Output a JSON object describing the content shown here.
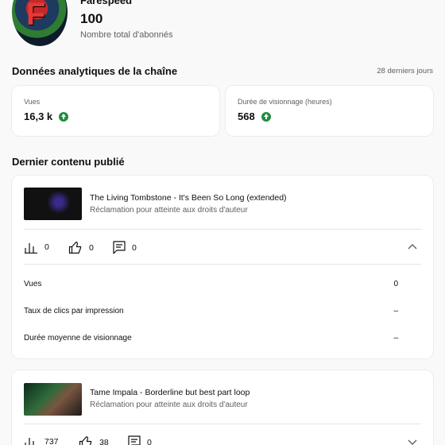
{
  "channel": {
    "name": "Farespeed",
    "avatar_letter": "F",
    "subscriber_count": "100",
    "subscriber_label": "Nombre total d'abonnés"
  },
  "analytics": {
    "title": "Données analytiques de la chaîne",
    "period": "28 derniers jours",
    "stats": [
      {
        "label": "Vues",
        "value": "16,3 k",
        "trend": "up"
      },
      {
        "label": "Durée de visionnage (heures)",
        "value": "568",
        "trend": "up"
      }
    ]
  },
  "latest": {
    "title": "Dernier contenu publié",
    "videos": [
      {
        "title": "The Living Tombstone - It's Been So Long (extended)",
        "claim": "Réclamation pour atteinte aux droits d'auteur",
        "views": "0",
        "likes": "0",
        "comments": "0",
        "expanded": true,
        "details": [
          {
            "label": "Vues",
            "value": "0"
          },
          {
            "label": "Taux de clics par impression",
            "value": "–"
          },
          {
            "label": "Durée moyenne de visionnage",
            "value": "–"
          }
        ]
      },
      {
        "title": "Tame Impala - Borderline but best part loop",
        "claim": "Réclamation pour atteinte aux droits d'auteur",
        "views": "737",
        "likes": "38",
        "comments": "0",
        "expanded": false
      }
    ]
  },
  "colors": {
    "trend_up": "#1e8e3e",
    "secondary_text": "#606060"
  }
}
